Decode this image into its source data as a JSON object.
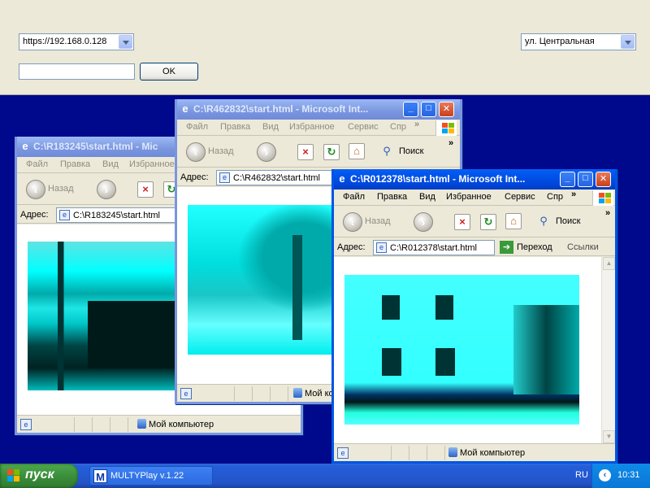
{
  "app_panel": {
    "url_select": "https://192.168.0.128",
    "street_select": "ул. Центральная",
    "text_input_value": "",
    "ok_label": "OK"
  },
  "windows": [
    {
      "title": "C:\\R183245\\start.html - Mic",
      "menu": [
        "Файл",
        "Правка",
        "Вид",
        "Избранное"
      ],
      "back_label": "Назад",
      "address_label": "Адрес:",
      "address": "C:\\R183245\\start.html",
      "status_zone": "Мой компьютер"
    },
    {
      "title": "C:\\R462832\\start.html - Microsoft Int...",
      "menu": [
        "Файл",
        "Правка",
        "Вид",
        "Избранное",
        "Сервис",
        "Спр"
      ],
      "back_label": "Назад",
      "search_label": "Поиск",
      "address_label": "Адрес:",
      "address": "C:\\R462832\\start.html",
      "status_zone": "Мой компьютер"
    },
    {
      "title": "C:\\R012378\\start.html - Microsoft Int...",
      "menu": [
        "Файл",
        "Правка",
        "Вид",
        "Избранное",
        "Сервис",
        "Спр"
      ],
      "back_label": "Назад",
      "search_label": "Поиск",
      "address_label": "Адрес:",
      "address": "C:\\R012378\\start.html",
      "go_label": "Переход",
      "links_label": "Ссылки",
      "status_zone": "Мой компьютер"
    }
  ],
  "taskbar": {
    "start_label": "пуск",
    "task_label": "MULTYPlay v.1.22",
    "language": "RU",
    "clock": "10:31"
  },
  "colors": {
    "desktop": "#00098c",
    "camera_tint": "#00ffff",
    "title_active": "#0054e3"
  }
}
